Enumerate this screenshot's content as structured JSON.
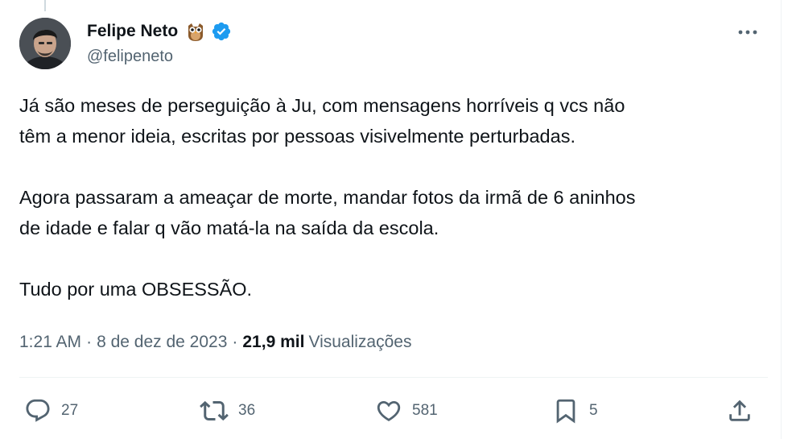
{
  "author": {
    "display_name": "Felipe Neto",
    "handle": "@felipeneto",
    "emoji": "owl-emoji",
    "verified": true,
    "verified_color": "#1d9bf0"
  },
  "tweet": {
    "paragraphs": [
      "Já são meses de perseguição à Ju, com mensagens horríveis q vcs não\ntêm a menor ideia, escritas por pessoas visivelmente perturbadas.",
      "Agora passaram a ameaçar de morte, mandar fotos da irmã de 6 aninhos\nde idade e falar q vão matá-la na saída da escola.",
      "Tudo por uma OBSESSÃO."
    ]
  },
  "meta": {
    "time": "1:21 AM",
    "date": "8 de dez de 2023",
    "separator": "·",
    "views_count": "21,9 mil",
    "views_label": "Visualizações"
  },
  "actions": {
    "reply": {
      "icon": "reply-icon",
      "count": "27"
    },
    "retweet": {
      "icon": "retweet-icon",
      "count": "36"
    },
    "like": {
      "icon": "heart-icon",
      "count": "581"
    },
    "bookmark": {
      "icon": "bookmark-icon",
      "count": "5"
    },
    "share": {
      "icon": "share-icon"
    }
  },
  "colors": {
    "text_primary": "#0f1419",
    "text_secondary": "#536471",
    "accent": "#1d9bf0",
    "divider": "#eff3f4"
  }
}
